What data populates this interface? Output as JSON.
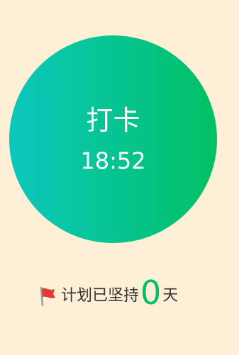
{
  "punch": {
    "label": "打卡",
    "time": "18:52"
  },
  "streak": {
    "icon": "flag-icon",
    "prefix": "计划已坚持",
    "count": "0",
    "suffix": "天"
  },
  "colors": {
    "background": "#FDF0D6",
    "gradient_start": "#0CC7BC",
    "gradient_end": "#02C063",
    "count_color": "#00BE6A",
    "flag_color": "#E23A3A"
  }
}
